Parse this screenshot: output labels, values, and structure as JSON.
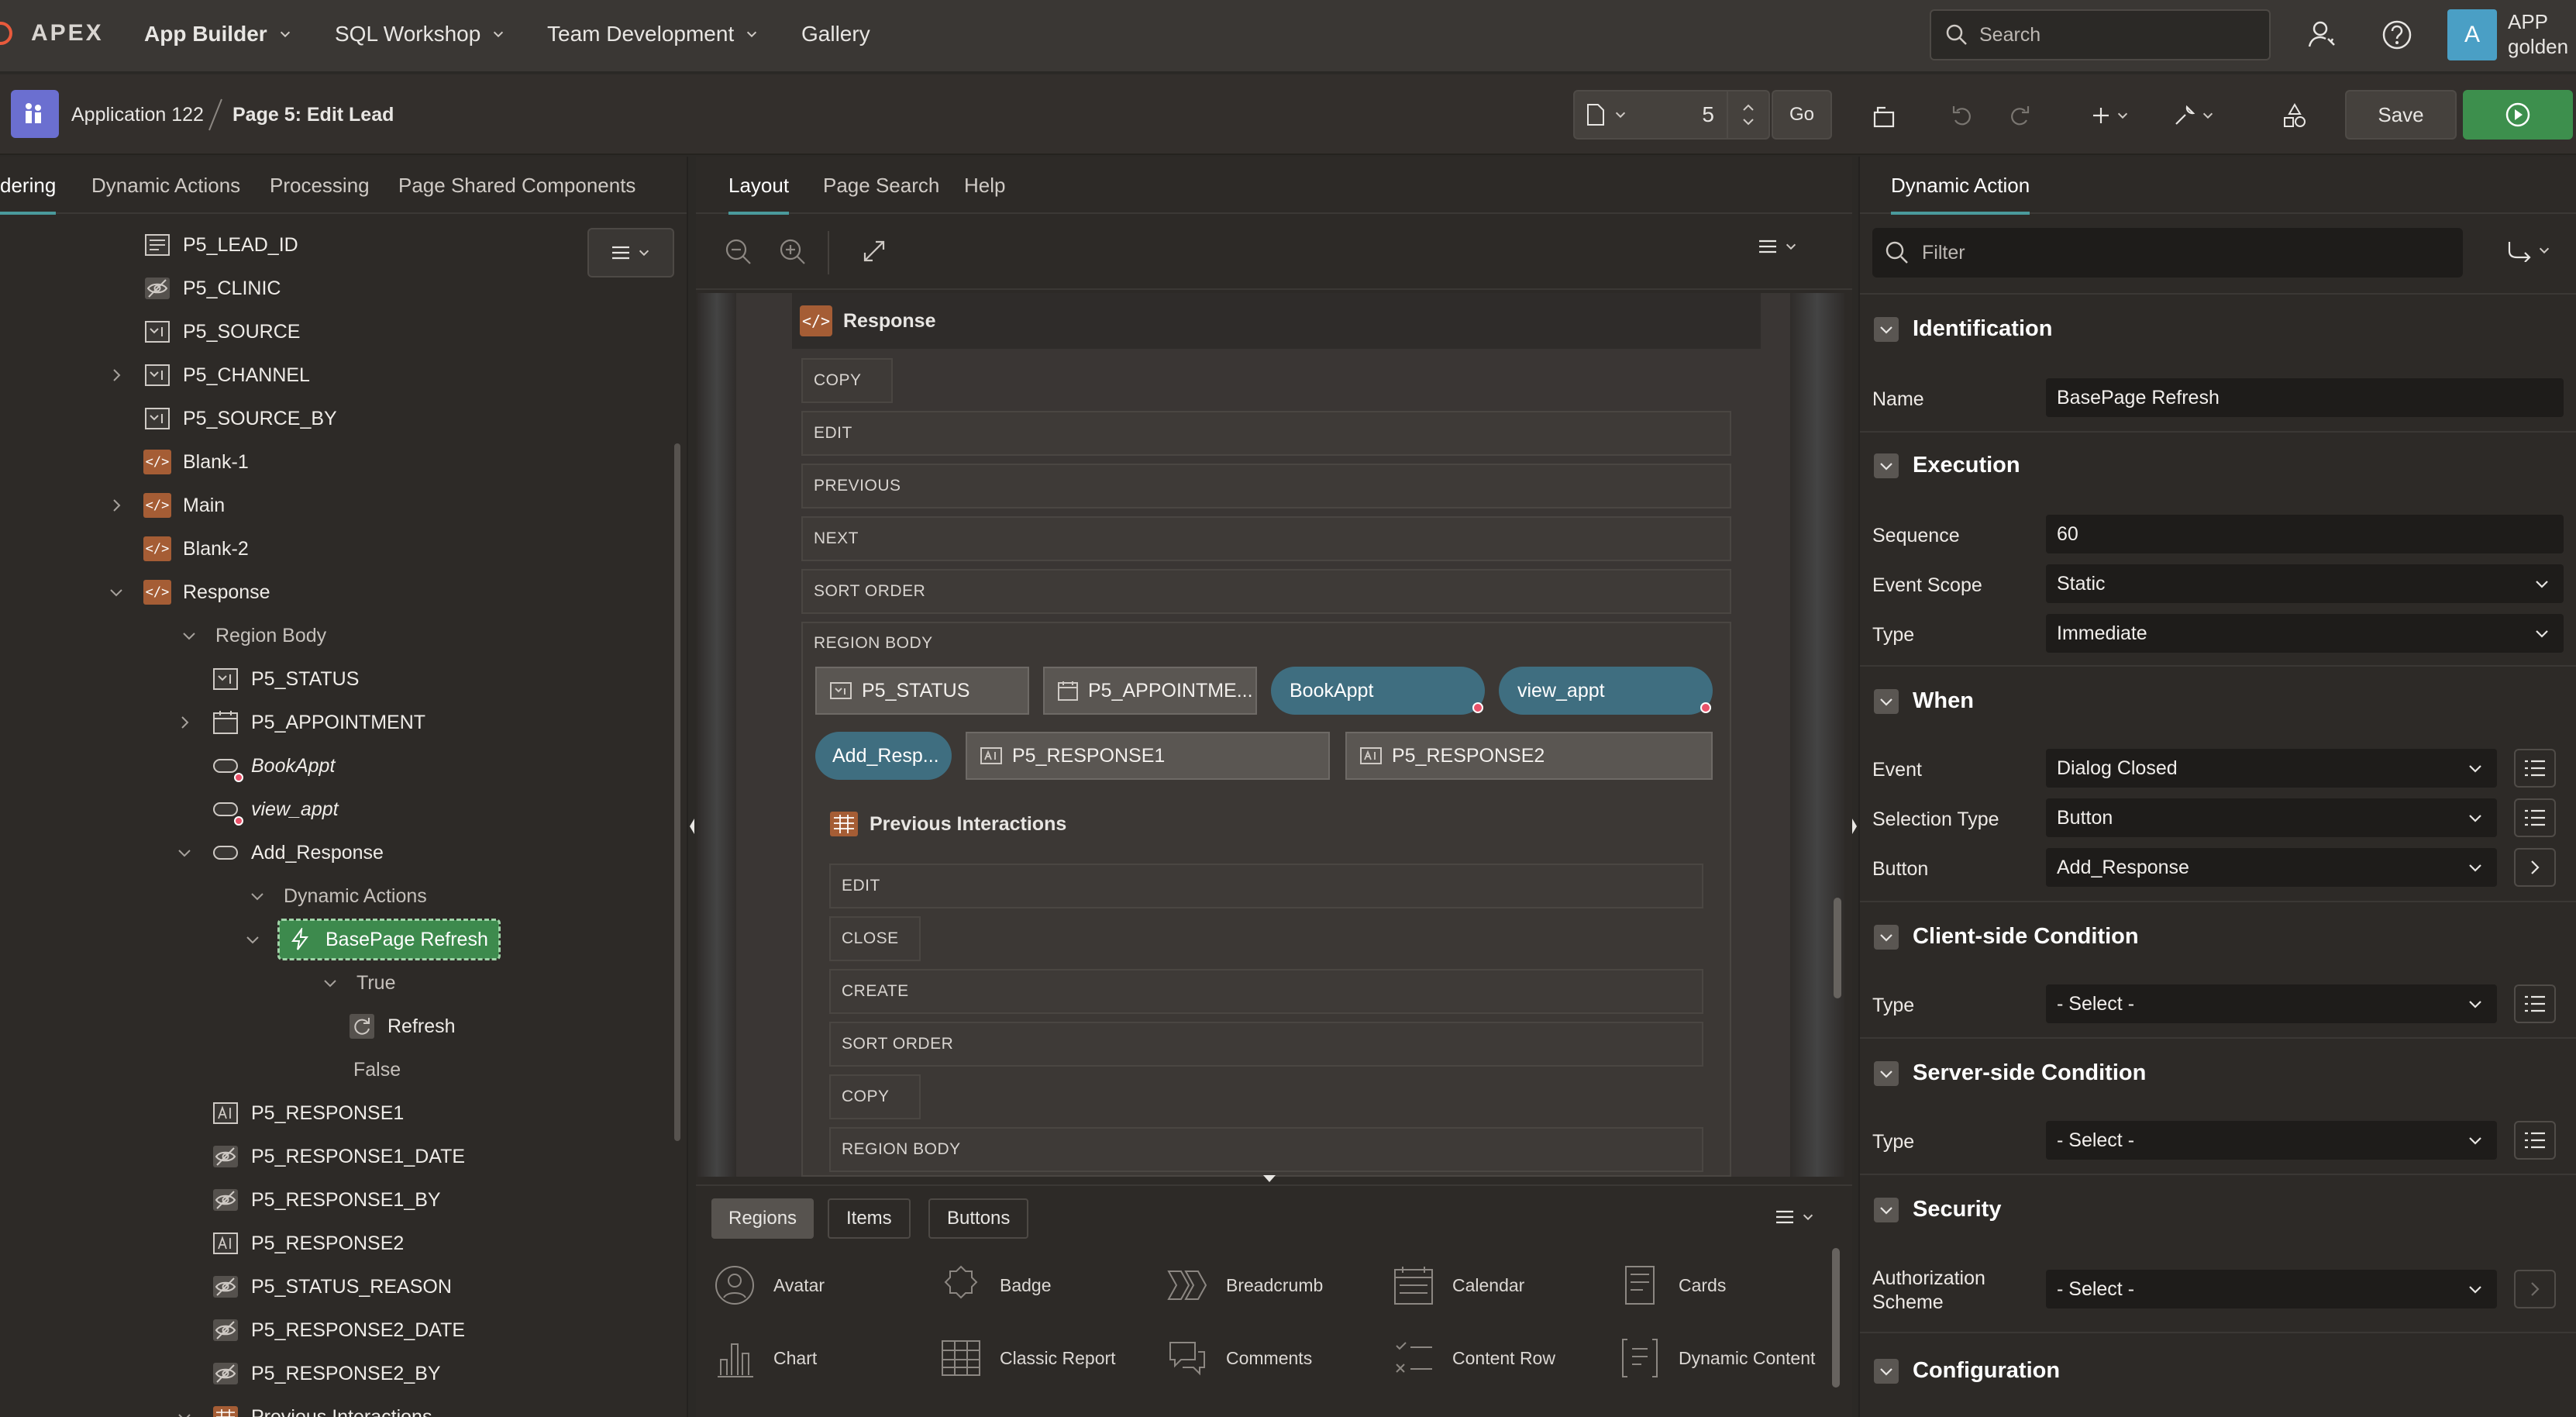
{
  "topnav": {
    "brand": "APEX",
    "menus": [
      "App Builder",
      "SQL Workshop",
      "Team Development",
      "Gallery"
    ],
    "search_placeholder": "Search",
    "user_initial": "A",
    "user_app": "APP",
    "user_name": "golden"
  },
  "pagebar": {
    "application": "Application 122",
    "page_title": "Page 5: Edit Lead",
    "page_number": "5",
    "go_label": "Go",
    "save_label": "Save"
  },
  "left": {
    "tabs": [
      "dering",
      "Dynamic Actions",
      "Processing",
      "Page Shared Components"
    ],
    "tree": [
      {
        "label": "P5_LEAD_ID",
        "icon": "hidden-item-icon"
      },
      {
        "label": "P5_CLINIC",
        "icon": "eye-off-icon"
      },
      {
        "label": "P5_SOURCE",
        "icon": "select-list-icon"
      },
      {
        "label": "P5_CHANNEL",
        "icon": "select-list-icon"
      },
      {
        "label": "P5_SOURCE_BY",
        "icon": "select-list-icon"
      },
      {
        "label": "Blank-1",
        "icon": "region-code-icon"
      },
      {
        "label": "Main",
        "icon": "region-code-icon"
      },
      {
        "label": "Blank-2",
        "icon": "region-code-icon"
      },
      {
        "label": "Response",
        "icon": "region-code-icon"
      },
      {
        "label": "Region Body",
        "icon": ""
      },
      {
        "label": "P5_STATUS",
        "icon": "select-list-icon"
      },
      {
        "label": "P5_APPOINTMENT",
        "icon": "calendar-icon"
      },
      {
        "label": "BookAppt",
        "icon": "button-icon"
      },
      {
        "label": "view_appt",
        "icon": "button-icon"
      },
      {
        "label": "Add_Response",
        "icon": "button-icon"
      },
      {
        "label": "Dynamic Actions",
        "icon": ""
      },
      {
        "label": "BasePage Refresh",
        "icon": "lightning-icon"
      },
      {
        "label": "True",
        "icon": ""
      },
      {
        "label": "Refresh",
        "icon": "refresh-icon"
      },
      {
        "label": "False",
        "icon": ""
      },
      {
        "label": "P5_RESPONSE1",
        "icon": "text-item-icon"
      },
      {
        "label": "P5_RESPONSE1_DATE",
        "icon": "eye-off-icon"
      },
      {
        "label": "P5_RESPONSE1_BY",
        "icon": "eye-off-icon"
      },
      {
        "label": "P5_RESPONSE2",
        "icon": "text-item-icon"
      },
      {
        "label": "P5_STATUS_REASON",
        "icon": "eye-off-icon"
      },
      {
        "label": "P5_RESPONSE2_DATE",
        "icon": "eye-off-icon"
      },
      {
        "label": "P5_RESPONSE2_BY",
        "icon": "eye-off-icon"
      },
      {
        "label": "Previous Interactions",
        "icon": "report-icon"
      }
    ]
  },
  "middle": {
    "tabs": [
      "Layout",
      "Page Search",
      "Help"
    ],
    "region_title": "Response",
    "slots": [
      "COPY",
      "EDIT",
      "PREVIOUS",
      "NEXT",
      "SORT ORDER",
      "REGION BODY"
    ],
    "chips": [
      "P5_STATUS",
      "P5_APPOINTME...",
      "P5_RESPONSE1",
      "P5_RESPONSE2"
    ],
    "pills": [
      "BookAppt",
      "view_appt",
      "Add_Resp..."
    ],
    "sub_region_title": "Previous Interactions",
    "sub_slots": [
      "EDIT",
      "CLOSE",
      "CREATE",
      "SORT ORDER",
      "COPY",
      "REGION BODY"
    ],
    "gallery_tabs": [
      "Regions",
      "Items",
      "Buttons"
    ],
    "gallery_items": [
      "Avatar",
      "Badge",
      "Breadcrumb",
      "Calendar",
      "Cards",
      "Chart",
      "Classic Report",
      "Comments",
      "Content Row",
      "Dynamic Content"
    ]
  },
  "right": {
    "tab": "Dynamic Action",
    "filter_placeholder": "Filter",
    "sections": {
      "identification": "Identification",
      "execution": "Execution",
      "when": "When",
      "client_condition": "Client-side Condition",
      "server_condition": "Server-side Condition",
      "security": "Security",
      "configuration": "Configuration"
    },
    "props": {
      "name_label": "Name",
      "name_value": "BasePage Refresh",
      "sequence_label": "Sequence",
      "sequence_value": "60",
      "scope_label": "Event Scope",
      "scope_value": "Static",
      "type_label": "Type",
      "type_value": "Immediate",
      "event_label": "Event",
      "event_value": "Dialog Closed",
      "seltype_label": "Selection Type",
      "seltype_value": "Button",
      "button_label": "Button",
      "button_value": "Add_Response",
      "ctype_label": "Type",
      "ctype_value": "- Select -",
      "stype_label": "Type",
      "stype_value": "- Select -",
      "auth_label": "Authorization Scheme",
      "auth_value": "- Select -"
    }
  }
}
